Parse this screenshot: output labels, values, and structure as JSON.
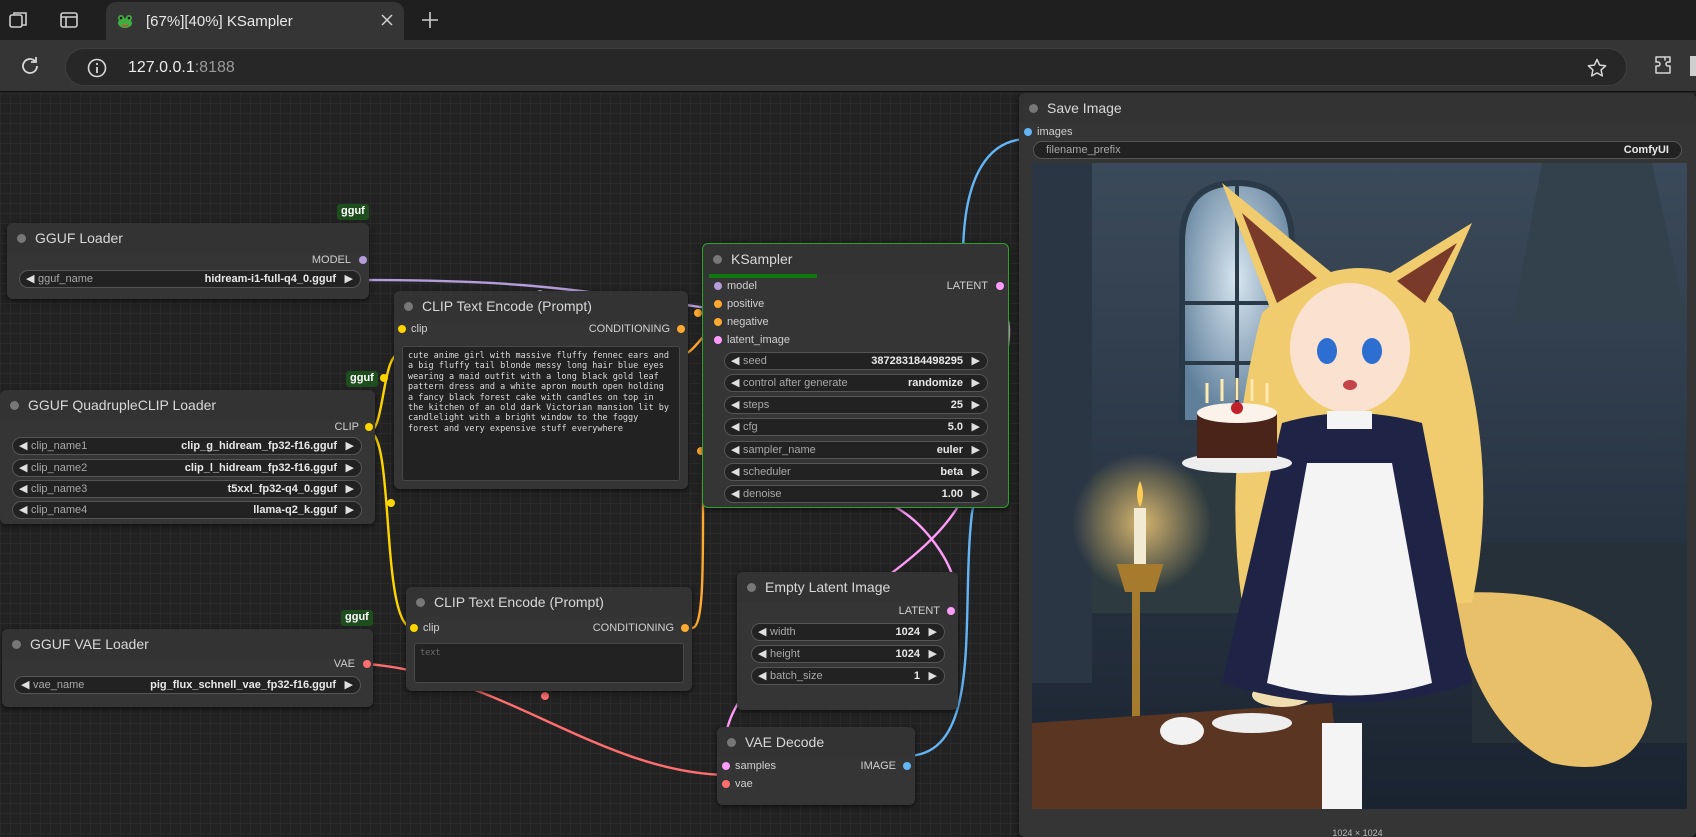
{
  "browser": {
    "tab_title": "[67%][40%] KSampler",
    "url_host": "127.0.0.1",
    "url_port": ":8188"
  },
  "colors": {
    "model": "#b39ddb",
    "clip": "#ffd500",
    "conditioning": "#ffa931",
    "latent": "#ff9cf9",
    "vae": "#ff6e6e",
    "image": "#64b5f6",
    "badge_bg": "#1e4d1e",
    "progress": "#0e7a0e",
    "active_border": "#2fa12f"
  },
  "icons": [
    "workspaces-icon",
    "tab-actions-icon",
    "frog-favicon-icon",
    "close-icon",
    "new-tab-icon",
    "reload-icon",
    "info-icon",
    "star-icon",
    "extensions-icon"
  ],
  "nodes": {
    "gguf_loader": {
      "badge": "gguf",
      "title": "GGUF Loader",
      "out_model": "MODEL",
      "widgets": [
        {
          "name": "gguf_name",
          "value": "hidream-i1-full-q4_0.gguf"
        }
      ]
    },
    "clip_loader": {
      "badge": "gguf",
      "title": "GGUF QuadrupleCLIP Loader",
      "out_clip": "CLIP",
      "widgets": [
        {
          "name": "clip_name1",
          "value": "clip_g_hidream_fp32-f16.gguf"
        },
        {
          "name": "clip_name2",
          "value": "clip_l_hidream_fp32-f16.gguf"
        },
        {
          "name": "clip_name3",
          "value": "t5xxl_fp32-q4_0.gguf"
        },
        {
          "name": "clip_name4",
          "value": "llama-q2_k.gguf"
        }
      ]
    },
    "vae_loader": {
      "badge": "gguf",
      "title": "GGUF VAE Loader",
      "out_vae": "VAE",
      "widgets": [
        {
          "name": "vae_name",
          "value": "pig_flux_schnell_vae_fp32-f16.gguf"
        }
      ]
    },
    "clip_pos": {
      "title": "CLIP Text Encode (Prompt)",
      "in_clip": "clip",
      "out_cond": "CONDITIONING",
      "text": "cute anime girl with massive fluffy fennec ears and a big fluffy tail blonde messy long hair blue eyes wearing a maid outfit with a long black gold leaf pattern dress and a white apron mouth open holding a fancy black forest cake with candles on top in the kitchen of an old dark Victorian mansion lit by candlelight with a bright window to the foggy forest and very expensive stuff everywhere"
    },
    "clip_neg": {
      "title": "CLIP Text Encode (Prompt)",
      "in_clip": "clip",
      "out_cond": "CONDITIONING",
      "placeholder": "text"
    },
    "ksampler": {
      "title": "KSampler",
      "progress": 0.4,
      "inputs": [
        "model",
        "positive",
        "negative",
        "latent_image"
      ],
      "out_latent": "LATENT",
      "widgets": [
        {
          "name": "seed",
          "value": "387283184498295"
        },
        {
          "name": "control after generate",
          "value": "randomize"
        },
        {
          "name": "steps",
          "value": "25"
        },
        {
          "name": "cfg",
          "value": "5.0"
        },
        {
          "name": "sampler_name",
          "value": "euler"
        },
        {
          "name": "scheduler",
          "value": "beta"
        },
        {
          "name": "denoise",
          "value": "1.00"
        }
      ]
    },
    "empty_latent": {
      "title": "Empty Latent Image",
      "out_latent": "LATENT",
      "widgets": [
        {
          "name": "width",
          "value": "1024"
        },
        {
          "name": "height",
          "value": "1024"
        },
        {
          "name": "batch_size",
          "value": "1"
        }
      ]
    },
    "vae_decode": {
      "title": "VAE Decode",
      "in_samples": "samples",
      "in_vae": "vae",
      "out_image": "IMAGE"
    },
    "save_image": {
      "title": "Save Image",
      "in_images": "images",
      "widgets": [
        {
          "name": "filename_prefix",
          "value": "ComfyUI"
        }
      ],
      "image_size": "1024 × 1024"
    }
  }
}
